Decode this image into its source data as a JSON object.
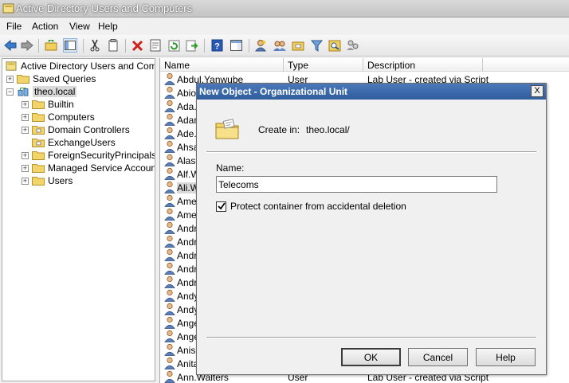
{
  "window": {
    "title": "Active Directory Users and Computers"
  },
  "menu": [
    "File",
    "Action",
    "View",
    "Help"
  ],
  "toolbar": {
    "icons": [
      "back-arrow-icon",
      "forward-arrow-icon",
      "up-folder-icon",
      "show-console-tree-icon",
      "cut-icon",
      "copy-icon",
      "delete-icon",
      "properties-icon",
      "refresh-icon",
      "export-list-icon",
      "help-icon",
      "action-pane-icon",
      "new-user-icon",
      "new-group-icon",
      "new-ou-icon",
      "filter-icon",
      "find-icon",
      "add-to-group-icon"
    ]
  },
  "tree": {
    "root": "Active Directory Users and Comput",
    "saved_queries": "Saved Queries",
    "domain": "theo.local",
    "children": [
      "Builtin",
      "Computers",
      "Domain Controllers",
      "ExchangeUsers",
      "ForeignSecurityPrincipals",
      "Managed Service Accounts",
      "Users"
    ]
  },
  "list": {
    "columns": [
      "Name",
      "Type",
      "Description"
    ],
    "rows": [
      {
        "name": "Abdul.Yanwube",
        "type": "User",
        "desc": "Lab User - created via Script"
      },
      {
        "name": "Abiol",
        "type": "",
        "desc": ""
      },
      {
        "name": "Ada.",
        "type": "",
        "desc": ""
      },
      {
        "name": "Adam",
        "type": "",
        "desc": ""
      },
      {
        "name": "Ade.",
        "type": "",
        "desc": ""
      },
      {
        "name": "Ahsa",
        "type": "",
        "desc": ""
      },
      {
        "name": "Alasc",
        "type": "",
        "desc": ""
      },
      {
        "name": "Alf.W",
        "type": "",
        "desc": ""
      },
      {
        "name": "Ali.W",
        "type": "",
        "desc": ""
      },
      {
        "name": "Ameli",
        "type": "",
        "desc": ""
      },
      {
        "name": "Amer",
        "type": "",
        "desc": ""
      },
      {
        "name": "Andr",
        "type": "",
        "desc": ""
      },
      {
        "name": "Andr",
        "type": "",
        "desc": ""
      },
      {
        "name": "Andr",
        "type": "",
        "desc": ""
      },
      {
        "name": "Andr",
        "type": "",
        "desc": ""
      },
      {
        "name": "Andr",
        "type": "",
        "desc": ""
      },
      {
        "name": "Andy",
        "type": "",
        "desc": ""
      },
      {
        "name": "Andy",
        "type": "",
        "desc": ""
      },
      {
        "name": "Ange",
        "type": "",
        "desc": ""
      },
      {
        "name": "Ange",
        "type": "",
        "desc": ""
      },
      {
        "name": "Anish",
        "type": "",
        "desc": ""
      },
      {
        "name": "Anita",
        "type": "",
        "desc": ""
      },
      {
        "name": "Ann.Walters",
        "type": "User",
        "desc": "Lab User - created via Script"
      }
    ]
  },
  "dialog": {
    "title": "New Object - Organizational Unit",
    "close": "X",
    "create_in_label": "Create in:",
    "create_in_value": "theo.local/",
    "name_label": "Name:",
    "name_value": "Telecoms",
    "protect_label": "Protect container from accidental deletion",
    "protect_checked": true,
    "ok": "OK",
    "cancel": "Cancel",
    "help": "Help"
  }
}
